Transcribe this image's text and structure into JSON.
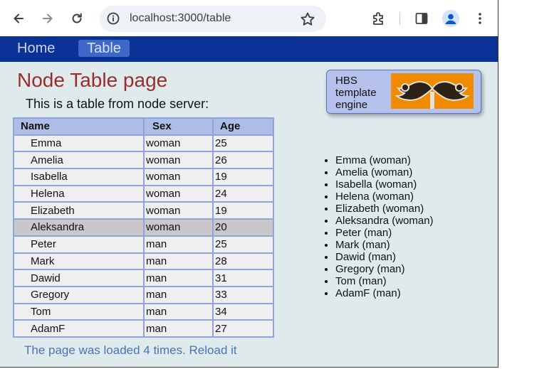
{
  "browser": {
    "url": "localhost:3000/table",
    "icons": {
      "back": "arrow-back-icon",
      "forward": "arrow-forward-icon",
      "reload": "reload-icon",
      "info": "site-info-icon",
      "bookmark": "star-icon",
      "extensions": "puzzle-icon",
      "sidepanel": "side-panel-icon",
      "profile": "profile-icon",
      "menu": "more-vert-icon"
    }
  },
  "nav": {
    "home": "Home",
    "table": "Table"
  },
  "page": {
    "title": "Node Table page",
    "subtitle": "This is a table from node server:",
    "footer": "The page was loaded 4 times. Reload it"
  },
  "hbs": {
    "text": "HBS template engine",
    "logo_icon": "mustache-icon"
  },
  "table": {
    "headers": [
      "Name",
      "Sex",
      "Age"
    ],
    "rows": [
      {
        "name": "Emma",
        "sex": "woman",
        "age": "25"
      },
      {
        "name": "Amelia",
        "sex": "woman",
        "age": "26"
      },
      {
        "name": "Isabella",
        "sex": "woman",
        "age": "19"
      },
      {
        "name": "Helena",
        "sex": "woman",
        "age": "24"
      },
      {
        "name": "Elizabeth",
        "sex": "woman",
        "age": "19"
      },
      {
        "name": "Aleksandra",
        "sex": "woman",
        "age": "20"
      },
      {
        "name": "Peter",
        "sex": "man",
        "age": "25"
      },
      {
        "name": "Mark",
        "sex": "man",
        "age": "28"
      },
      {
        "name": "Dawid",
        "sex": "man",
        "age": "31"
      },
      {
        "name": "Gregory",
        "sex": "man",
        "age": "33"
      },
      {
        "name": "Tom",
        "sex": "man",
        "age": "34"
      },
      {
        "name": "AdamF",
        "sex": "man",
        "age": "27"
      }
    ]
  },
  "list": [
    "Emma (woman)",
    "Amelia (woman)",
    "Isabella (woman)",
    "Helena (woman)",
    "Elizabeth (woman)",
    "Aleksandra (woman)",
    "Peter (man)",
    "Mark (man)",
    "Dawid (man)",
    "Gregory (man)",
    "Tom (man)",
    "AdamF (man)"
  ],
  "colors": {
    "navbar": "#0a3196",
    "title": "#9b2d2d",
    "footer_link": "#4b73b8",
    "page_bg": "#dfeaec",
    "logo_bg": "#f08a00"
  }
}
